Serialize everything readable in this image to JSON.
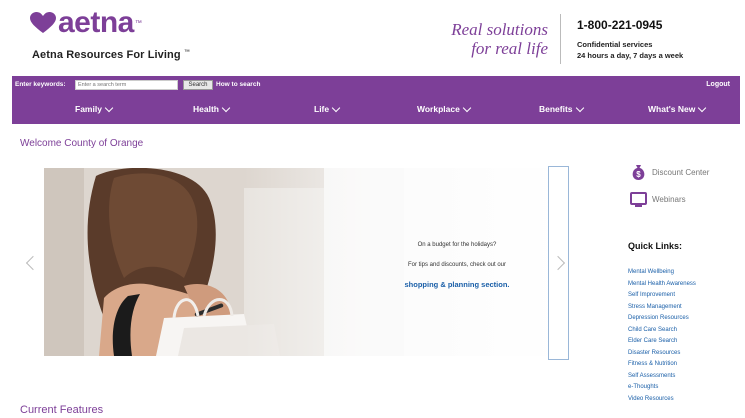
{
  "brand": {
    "logo_text": "aetna",
    "logo_mark": "™",
    "subtitle": "Aetna Resources For Living",
    "subtitle_mark": "™",
    "tagline_line1": "Real solutions",
    "tagline_line2": "for real life",
    "phone": "1-800-221-0945",
    "confidential_line1": "Confidential services",
    "confidential_line2": "24 hours a day, 7 days a week",
    "accent_color": "#7d3f98"
  },
  "search": {
    "label": "Enter keywords:",
    "placeholder": "Enter a search term",
    "button_label": "Search",
    "howto_label": "How to search"
  },
  "nav": {
    "logout_label": "Logout",
    "items": [
      {
        "label": "Family"
      },
      {
        "label": "Health"
      },
      {
        "label": "Life"
      },
      {
        "label": "Workplace"
      },
      {
        "label": "Benefits"
      },
      {
        "label": "What's New"
      }
    ]
  },
  "welcome": "Welcome County of Orange",
  "slide": {
    "text1": "On a budget for the holidays?",
    "text2": "For tips and discounts, check out our",
    "link_label": "shopping & planning section."
  },
  "sidebar": {
    "discount_label": "Discount Center",
    "discount_icon": "money-bag-icon",
    "webinars_label": "Webinars",
    "webinars_icon": "monitor-icon",
    "quick_links_title": "Quick Links:",
    "quick_links": [
      "Mental Wellbeing",
      "Mental Health Awareness",
      "Self Improvement",
      "Stress Management",
      "Depression Resources",
      "Child Care Search",
      "Elder Care Search",
      "Disaster Resources",
      "Fitness & Nutrition",
      "Self Assessments",
      "e-Thoughts",
      "Video Resources"
    ]
  },
  "features_title": "Current Features"
}
